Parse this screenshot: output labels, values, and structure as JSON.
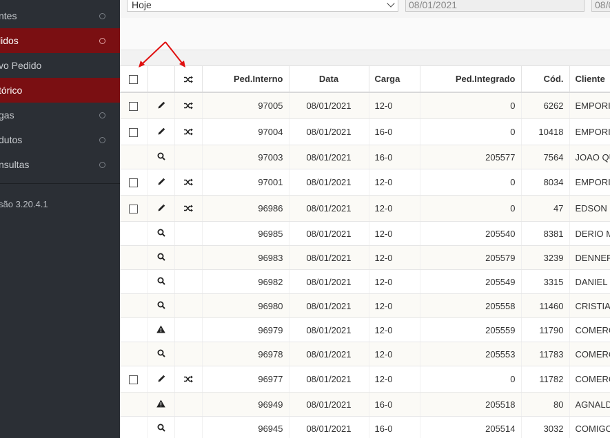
{
  "sidebar": {
    "items": [
      {
        "label": "ntes",
        "active": false,
        "dot": true
      },
      {
        "label": "lidos",
        "active": true,
        "dot": true
      },
      {
        "label": "vo Pedido",
        "active": false,
        "dot": false
      },
      {
        "label": "tórico",
        "active": true,
        "dot": false
      },
      {
        "label": "gas",
        "active": false,
        "dot": true
      },
      {
        "label": "dutos",
        "active": false,
        "dot": true
      },
      {
        "label": "nsultas",
        "active": false,
        "dot": true
      }
    ],
    "version": "são 3.20.4.1"
  },
  "filters": {
    "period": "Hoje",
    "date_from": "08/01/2021",
    "date_to": "08/0"
  },
  "table": {
    "columns": [
      "",
      "",
      "",
      "Ped.Interno",
      "Data",
      "Carga",
      "Ped.Integrado",
      "Cód.",
      "Cliente"
    ],
    "rows": [
      {
        "type": "edit",
        "ped_interno": "97005",
        "data": "08/01/2021",
        "carga": "12-0",
        "ped_integrado": "0",
        "cod": "6262",
        "cliente": "EMPORI"
      },
      {
        "type": "edit",
        "ped_interno": "97004",
        "data": "08/01/2021",
        "carga": "16-0",
        "ped_integrado": "0",
        "cod": "10418",
        "cliente": "EMPORI"
      },
      {
        "type": "view",
        "ped_interno": "97003",
        "data": "08/01/2021",
        "carga": "16-0",
        "ped_integrado": "205577",
        "cod": "7564",
        "cliente": "JOAO QU"
      },
      {
        "type": "edit",
        "ped_interno": "97001",
        "data": "08/01/2021",
        "carga": "12-0",
        "ped_integrado": "0",
        "cod": "8034",
        "cliente": "EMPORI"
      },
      {
        "type": "edit",
        "ped_interno": "96986",
        "data": "08/01/2021",
        "carga": "12-0",
        "ped_integrado": "0",
        "cod": "47",
        "cliente": "EDSON I"
      },
      {
        "type": "view",
        "ped_interno": "96985",
        "data": "08/01/2021",
        "carga": "12-0",
        "ped_integrado": "205540",
        "cod": "8381",
        "cliente": "DERIO M"
      },
      {
        "type": "view",
        "ped_interno": "96983",
        "data": "08/01/2021",
        "carga": "12-0",
        "ped_integrado": "205579",
        "cod": "3239",
        "cliente": "DENNER"
      },
      {
        "type": "view",
        "ped_interno": "96982",
        "data": "08/01/2021",
        "carga": "12-0",
        "ped_integrado": "205549",
        "cod": "3315",
        "cliente": "DANIEL"
      },
      {
        "type": "view",
        "ped_interno": "96980",
        "data": "08/01/2021",
        "carga": "12-0",
        "ped_integrado": "205558",
        "cod": "11460",
        "cliente": "CRISTIAN"
      },
      {
        "type": "warn",
        "ped_interno": "96979",
        "data": "08/01/2021",
        "carga": "12-0",
        "ped_integrado": "205559",
        "cod": "11790",
        "cliente": "COMERC"
      },
      {
        "type": "view",
        "ped_interno": "96978",
        "data": "08/01/2021",
        "carga": "12-0",
        "ped_integrado": "205553",
        "cod": "11783",
        "cliente": "COMERC"
      },
      {
        "type": "edit",
        "ped_interno": "96977",
        "data": "08/01/2021",
        "carga": "12-0",
        "ped_integrado": "0",
        "cod": "11782",
        "cliente": "COMERC"
      },
      {
        "type": "warn",
        "ped_interno": "96949",
        "data": "08/01/2021",
        "carga": "16-0",
        "ped_integrado": "205518",
        "cod": "80",
        "cliente": "AGNALD"
      },
      {
        "type": "view",
        "ped_interno": "96945",
        "data": "08/01/2021",
        "carga": "16-0",
        "ped_integrado": "205514",
        "cod": "3032",
        "cliente": "COMIGO"
      }
    ]
  },
  "icons": {
    "checkbox": "checkbox-icon",
    "edit": "pencil-icon",
    "transfer": "shuffle-icon",
    "view": "search-icon",
    "warn": "warning-icon",
    "annotation": "red-arrow-icon"
  },
  "colors": {
    "sidebar_bg": "#2b2f35",
    "sidebar_active": "#7a0f12",
    "annotation": "#e01010"
  }
}
